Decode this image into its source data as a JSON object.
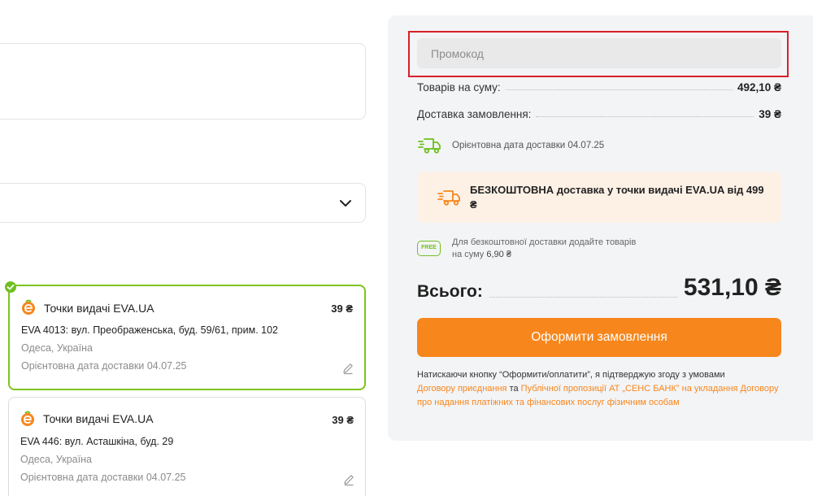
{
  "left": {
    "cards": [
      {
        "title": "Точки видачі EVA.UA",
        "price": "39 ₴",
        "address": "EVA 4013: вул. Преображенська, буд. 59/61, прим. 102",
        "city": "Одеса, Україна",
        "eta": "Орієнтовна дата доставки 04.07.25",
        "selected": true
      },
      {
        "title": "Точки видачі EVA.UA",
        "price": "39 ₴",
        "address": "EVA 446: вул. Асташкіна, буд. 29",
        "city": "Одеса, Україна",
        "eta": "Орієнтовна дата доставки 04.07.25",
        "selected": false
      }
    ]
  },
  "summary": {
    "promo_placeholder": "Промокод",
    "goods_label": "Товарів на суму:",
    "goods_value": "492,10 ₴",
    "delivery_label": "Доставка замовлення:",
    "delivery_value": "39 ₴",
    "eta_text": "Орієнтовна дата доставки 04.07.25",
    "free_banner": "БЕЗКОШТОВНА доставка у точки видачі EVA.UA від 499 ₴",
    "free_badge": "FREE",
    "free_note_line1": "Для безкоштовної доставки додайте товарів",
    "free_note_line2_prefix": "на суму ",
    "free_note_amount": "6,90 ₴",
    "total_label": "Всього:",
    "total_value": "531,10 ₴",
    "order_button": "Оформити замовлення",
    "terms_text": "Натискаючи кнопку “Оформити/оплатити”, я підтверджую згоду з умовами",
    "terms_link1": "Договору приєднання",
    "terms_and": " та ",
    "terms_link2": "Публічної пропозиції АТ „СЕНС БАНК” на укладання Договору про надання платіжних та фінансових послуг фізичним особам"
  },
  "colors": {
    "accent": "#f7861c",
    "green": "#6fc01f",
    "panel_bg": "#f3f4f6",
    "highlight_frame": "#d8202b"
  }
}
